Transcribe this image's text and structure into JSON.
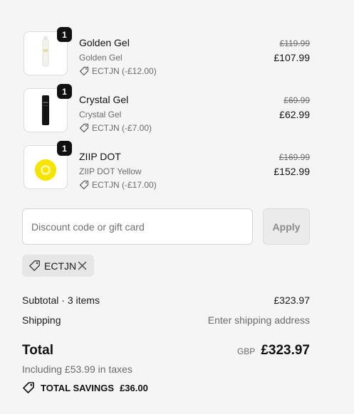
{
  "items": [
    {
      "name": "Golden Gel",
      "variant": "Golden Gel",
      "discount": "ECTJN (-£12.00)",
      "quantity": "1",
      "original_price": "£119.99",
      "price": "£107.99"
    },
    {
      "name": "Crystal Gel",
      "variant": "Crystal Gel",
      "discount": "ECTJN (-£7.00)",
      "quantity": "1",
      "original_price": "£69.99",
      "price": "£62.99"
    },
    {
      "name": "ZIIP DOT",
      "variant": "ZIIP DOT Yellow",
      "discount": "ECTJN (-£17.00)",
      "quantity": "1",
      "original_price": "£169.99",
      "price": "£152.99"
    }
  ],
  "discount": {
    "placeholder": "Discount code or gift card",
    "apply_label": "Apply",
    "applied_code": "ECTJN"
  },
  "summary": {
    "subtotal_label": "Subtotal · 3 items",
    "subtotal_value": "£323.97",
    "shipping_label": "Shipping",
    "shipping_value": "Enter shipping address",
    "total_label": "Total",
    "currency": "GBP",
    "total_value": "£323.97",
    "taxes_text": "Including £53.99 in taxes",
    "savings_label": "TOTAL SAVINGS",
    "savings_value": "£36.00"
  },
  "icons": {
    "discount": "tag-icon",
    "remove": "close-icon",
    "savings": "tag-icon"
  },
  "colors": {
    "background": "#f5f5f5",
    "badge": "#111111",
    "muted_text": "#6b6b6b",
    "product_yellow": "#f5e400"
  }
}
